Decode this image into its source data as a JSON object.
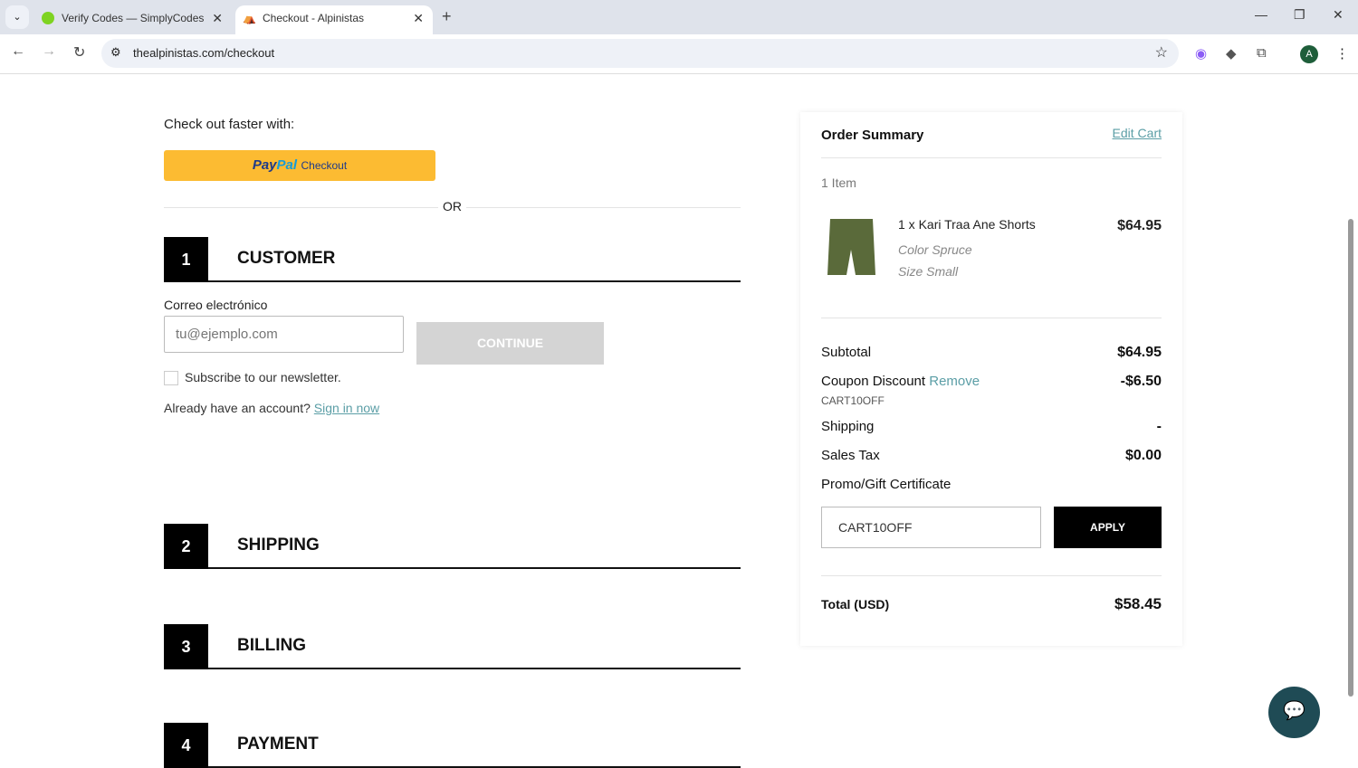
{
  "browser": {
    "tabs": [
      {
        "title": "Verify Codes — SimplyCodes",
        "active": false
      },
      {
        "title": "Checkout - Alpinistas",
        "active": true
      }
    ],
    "url": "thealpinistas.com/checkout",
    "profile_initial": "A"
  },
  "checkout": {
    "faster_label": "Check out faster with:",
    "paypal_brand_1": "Pay",
    "paypal_brand_2": "Pal",
    "paypal_label": "Checkout",
    "or_label": "OR",
    "steps": [
      {
        "num": "1",
        "label": "CUSTOMER"
      },
      {
        "num": "2",
        "label": "SHIPPING"
      },
      {
        "num": "3",
        "label": "BILLING"
      },
      {
        "num": "4",
        "label": "PAYMENT"
      }
    ],
    "email_label": "Correo electrónico",
    "email_placeholder": "tu@ejemplo.com",
    "continue_label": "CONTINUE",
    "newsletter_label": "Subscribe to our newsletter.",
    "account_prompt": "Already have an account?",
    "sign_in_label": "Sign in now"
  },
  "summary": {
    "title": "Order Summary",
    "edit_cart": "Edit Cart",
    "item_count": "1 Item",
    "item": {
      "name": "1 x Kari Traa Ane Shorts",
      "color": "Color Spruce",
      "size": "Size Small",
      "price": "$64.95"
    },
    "subtotal_label": "Subtotal",
    "subtotal": "$64.95",
    "coupon_label": "Coupon Discount",
    "remove_label": "Remove",
    "coupon_code": "CART10OFF",
    "coupon_value": "-$6.50",
    "shipping_label": "Shipping",
    "shipping": "-",
    "tax_label": "Sales Tax",
    "tax": "$0.00",
    "promo_label": "Promo/Gift Certificate",
    "promo_value": "CART10OFF",
    "apply_label": "APPLY",
    "total_label": "Total (USD)",
    "total": "$58.45"
  }
}
